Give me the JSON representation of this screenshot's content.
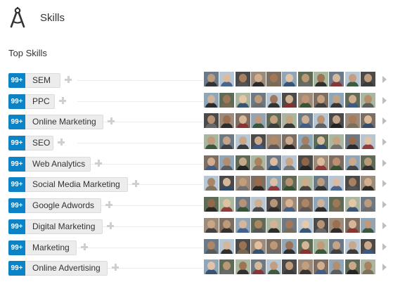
{
  "header": {
    "title": "Skills",
    "icon": "compass-icon"
  },
  "section": {
    "title": "Top Skills"
  },
  "endorsement_badge": "99+",
  "skills": [
    {
      "name": "SEM"
    },
    {
      "name": "PPC"
    },
    {
      "name": "Online Marketing"
    },
    {
      "name": "SEO"
    },
    {
      "name": "Web Analytics"
    },
    {
      "name": "Social Media Marketing"
    },
    {
      "name": "Google Adwords"
    },
    {
      "name": "Digital Marketing"
    },
    {
      "name": "Marketing"
    },
    {
      "name": "Online Advertising"
    }
  ],
  "endorser_avatars_per_row": 11,
  "colors": {
    "badge": "#0c83c7",
    "pill": "#ececec",
    "text": "#333333"
  }
}
